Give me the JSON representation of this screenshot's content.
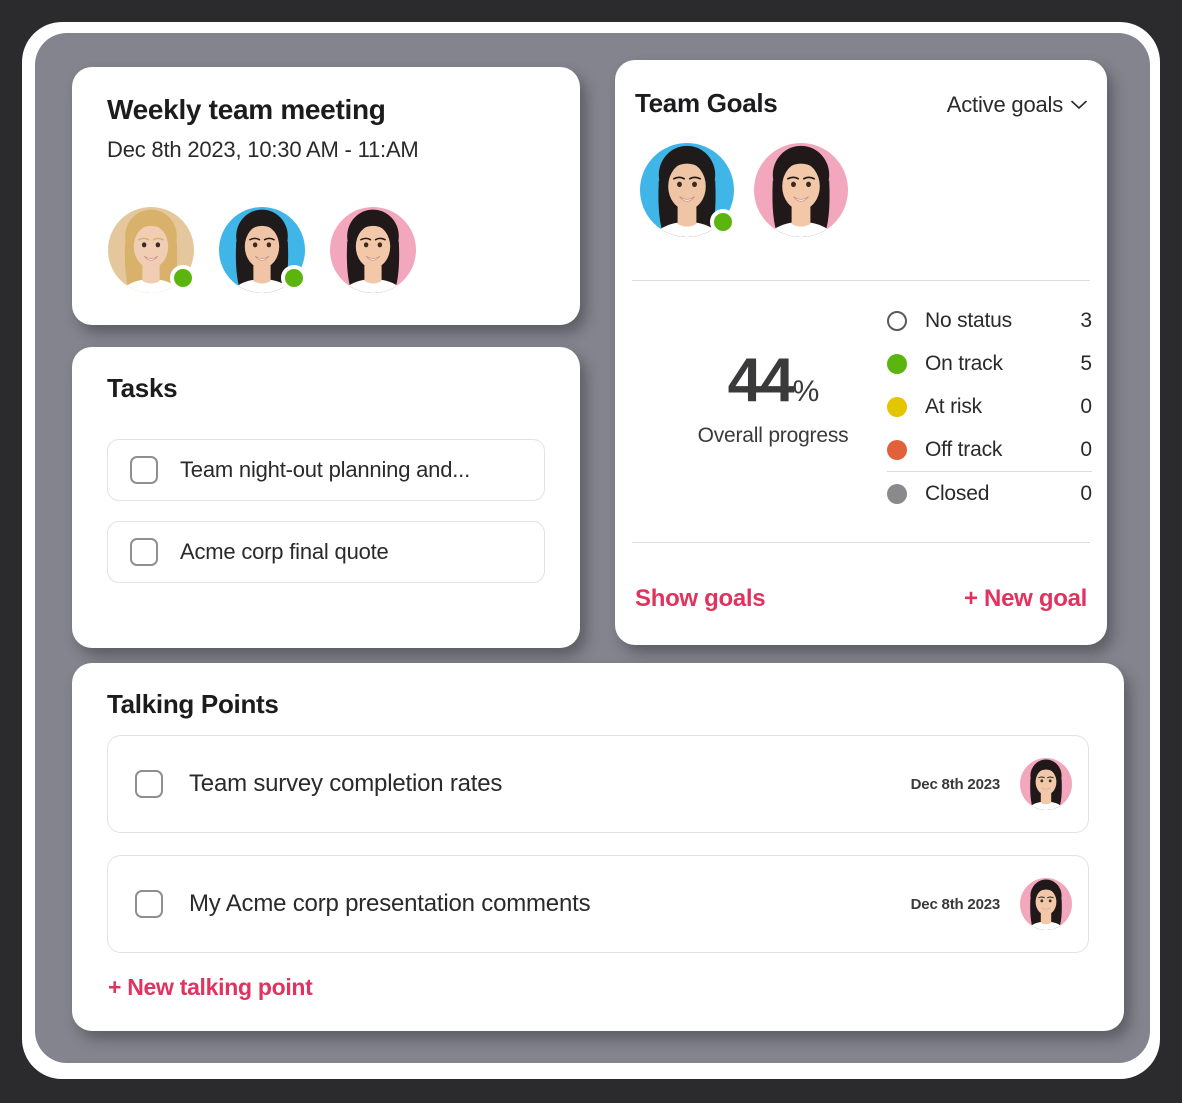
{
  "theme": {
    "accent": "#e0335f",
    "page_background": "#2b2b2d",
    "panel_background": "#84848e",
    "card_background": "#ffffff",
    "online_dot": "#5cb50f"
  },
  "meeting": {
    "title": "Weekly team meeting",
    "datetime": "Dec 8th 2023, 10:30 AM - 11:AM",
    "attendees": [
      {
        "name": "avatar-blonde-woman",
        "bg": "#e4c79c",
        "hair": "#d8b26a",
        "skin": "#f1cdb4",
        "online": true
      },
      {
        "name": "avatar-dark-hair-man",
        "bg": "#3fb5e8",
        "hair": "#1f1b1a",
        "skin": "#f0c5a6",
        "online": true
      },
      {
        "name": "avatar-dark-hair-woman",
        "bg": "#f3a7bd",
        "hair": "#21181a",
        "skin": "#f3c8a8",
        "online": false
      }
    ]
  },
  "tasks": {
    "heading": "Tasks",
    "items": [
      {
        "label": "Team night-out planning and...",
        "checked": false
      },
      {
        "label": "Acme corp final quote",
        "checked": false
      }
    ]
  },
  "goals": {
    "title": "Team Goals",
    "filter_label": "Active goals",
    "filter_icon": "chevron-down-icon",
    "owners": [
      {
        "name": "avatar-dark-hair-man",
        "bg": "#3fb5e8",
        "hair": "#1f1b1a",
        "skin": "#f0c5a6",
        "online": true
      },
      {
        "name": "avatar-dark-hair-woman",
        "bg": "#f3a7bd",
        "hair": "#21181a",
        "skin": "#f3c8a8",
        "online": false
      }
    ],
    "progress_value": "44",
    "progress_symbol": "%",
    "progress_label": "Overall progress",
    "statuses": [
      {
        "label": "No status",
        "count": "3",
        "color": "#ffffff",
        "hollow": true
      },
      {
        "label": "On track",
        "count": "5",
        "color": "#5cb50f",
        "hollow": false
      },
      {
        "label": "At risk",
        "count": "0",
        "color": "#e5c400",
        "hollow": false
      },
      {
        "label": "Off track",
        "count": "0",
        "color": "#e2603c",
        "hollow": false
      },
      {
        "label": "Closed",
        "count": "0",
        "color": "#8a8a8e",
        "hollow": false
      }
    ],
    "show_goals_label": "Show goals",
    "new_goal_label": "+ New goal"
  },
  "talking_points": {
    "heading": "Talking Points",
    "items": [
      {
        "label": "Team survey completion rates",
        "date": "Dec 8th 2023",
        "checked": false,
        "avatar": {
          "name": "avatar-dark-hair-woman",
          "bg": "#f3a7bd",
          "hair": "#21181a",
          "skin": "#f3c8a8"
        }
      },
      {
        "label": "My Acme corp presentation comments",
        "date": "Dec 8th 2023",
        "checked": false,
        "avatar": {
          "name": "avatar-dark-hair-woman",
          "bg": "#f3a7bd",
          "hair": "#21181a",
          "skin": "#f3c8a8"
        }
      }
    ],
    "new_label": "+ New talking point"
  }
}
